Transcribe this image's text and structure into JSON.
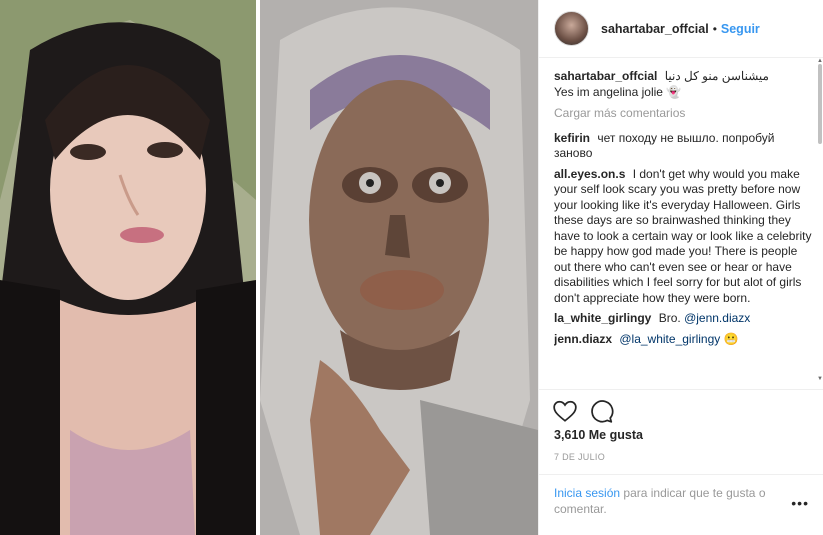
{
  "header": {
    "username": "sahartabar_offcial",
    "dot": "•",
    "follow_label": "Seguir"
  },
  "caption": {
    "username": "sahartabar_offcial",
    "text_rtl": "میشناسن منو کل دنیا",
    "text_en": "Yes im angelina jolie 👻"
  },
  "load_more_label": "Cargar más comentarios",
  "comments": [
    {
      "username": "kefirin",
      "text": "чет походу не вышло. попробуй заново"
    },
    {
      "username": "all.eyes.on.s",
      "text": "I don't get why would you make your self look scary you was pretty before now your looking like it's everyday Halloween. Girls these days are so brainwashed thinking they have to look a certain way or look like a celebrity be happy how god made you! There is people out there who can't even see or hear or have disabilities which I feel sorry for but alot of girls don't appreciate how they were born."
    },
    {
      "username": "la_white_girlingy",
      "text": "Bro.",
      "mention": "@jenn.diazx"
    },
    {
      "username": "jenn.diazx",
      "mention": "@la_white_girlingy",
      "text": "😬"
    }
  ],
  "likes_label": "3,610 Me gusta",
  "date_label": "7 DE JULIO",
  "footer": {
    "login_label": "Inicia sesión",
    "rest_text": "para indicar que te gusta o comentar."
  },
  "more_label": "•••",
  "icons": {
    "like": "heart-icon",
    "comment": "comment-icon",
    "more": "more-options-icon"
  }
}
